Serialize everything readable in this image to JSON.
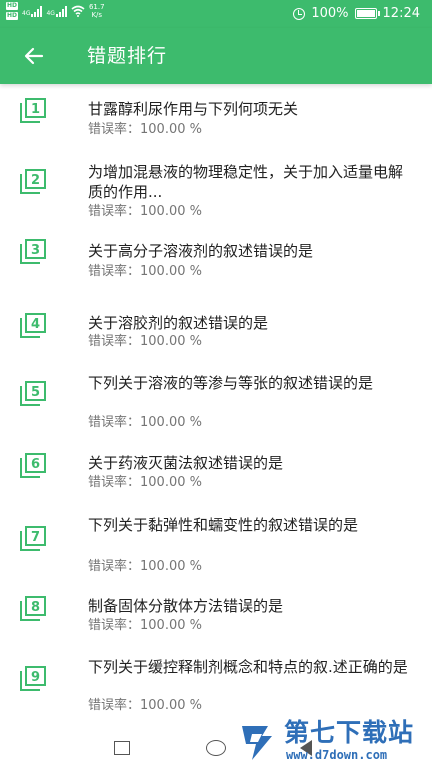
{
  "status_bar": {
    "sim1": "HD",
    "sim2": "HD",
    "signal1_label": "4G",
    "signal2_label": "4G",
    "speed_value": "61.7",
    "speed_unit": "K/s",
    "battery": "100%",
    "time": "12:24"
  },
  "header": {
    "title": "错题排行"
  },
  "items": [
    {
      "number": "1",
      "title": "甘露醇利尿作用与下列何项无关",
      "rate": "错误率：100.00 %"
    },
    {
      "number": "2",
      "title": "为增加混悬液的物理稳定性，关于加入适量电解质的作用...",
      "rate": "错误率：100.00 %"
    },
    {
      "number": "3",
      "title": "关于高分子溶液剂的叙述错误的是",
      "rate": "错误率：100.00 %"
    },
    {
      "number": "4",
      "title": "关于溶胶剂的叙述错误的是",
      "rate": "错误率：100.00 %"
    },
    {
      "number": "5",
      "title": "下列关于溶液的等渗与等张的叙述错误的是",
      "rate": "错误率：100.00 %"
    },
    {
      "number": "6",
      "title": "关于药液灭菌法叙述错误的是",
      "rate": "错误率：100.00 %"
    },
    {
      "number": "7",
      "title": "下列关于黏弹性和蠕变性的叙述错误的是",
      "rate": "错误率：100.00 %"
    },
    {
      "number": "8",
      "title": "制备固体分散体方法错误的是",
      "rate": "错误率：100.00 %"
    },
    {
      "number": "9",
      "title": "下列关于缓控释制剂概念和特点的叙.述正确的是",
      "rate": "错误率：100.00 %"
    }
  ],
  "watermark": {
    "title": "第七下载站",
    "url": "www.d7down.com"
  },
  "colors": {
    "primary": "#3dbb6d",
    "watermark": "#2f6fb8"
  }
}
